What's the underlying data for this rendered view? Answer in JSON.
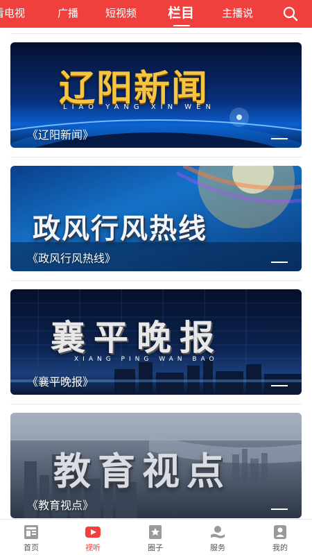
{
  "top_nav": {
    "tabs": [
      {
        "label": "看电视"
      },
      {
        "label": "广播"
      },
      {
        "label": "短视频"
      },
      {
        "label": "栏目"
      },
      {
        "label": "主播说"
      }
    ],
    "active_tab": "栏目",
    "accent_color": "#f0403d"
  },
  "programs": [
    {
      "label": "《辽阳新闻》",
      "art_title": "辽阳新闻",
      "art_subtitle": "LIAO YANG XIN WEN"
    },
    {
      "label": "《政风行风热线》",
      "art_title": "政风行风热线",
      "art_subtitle": ""
    },
    {
      "label": "《襄平晚报》",
      "art_title": "襄平晚报",
      "art_subtitle": "XIANG PING WAN BAO"
    },
    {
      "label": "《教育视点》",
      "art_title": "教育视点",
      "art_subtitle": ""
    }
  ],
  "bottom_nav": {
    "items": [
      {
        "label": "首页",
        "icon": "home-icon"
      },
      {
        "label": "视听",
        "icon": "play-icon"
      },
      {
        "label": "圈子",
        "icon": "star-icon"
      },
      {
        "label": "服务",
        "icon": "service-icon"
      },
      {
        "label": "我的",
        "icon": "user-icon"
      }
    ],
    "active": "视听"
  }
}
